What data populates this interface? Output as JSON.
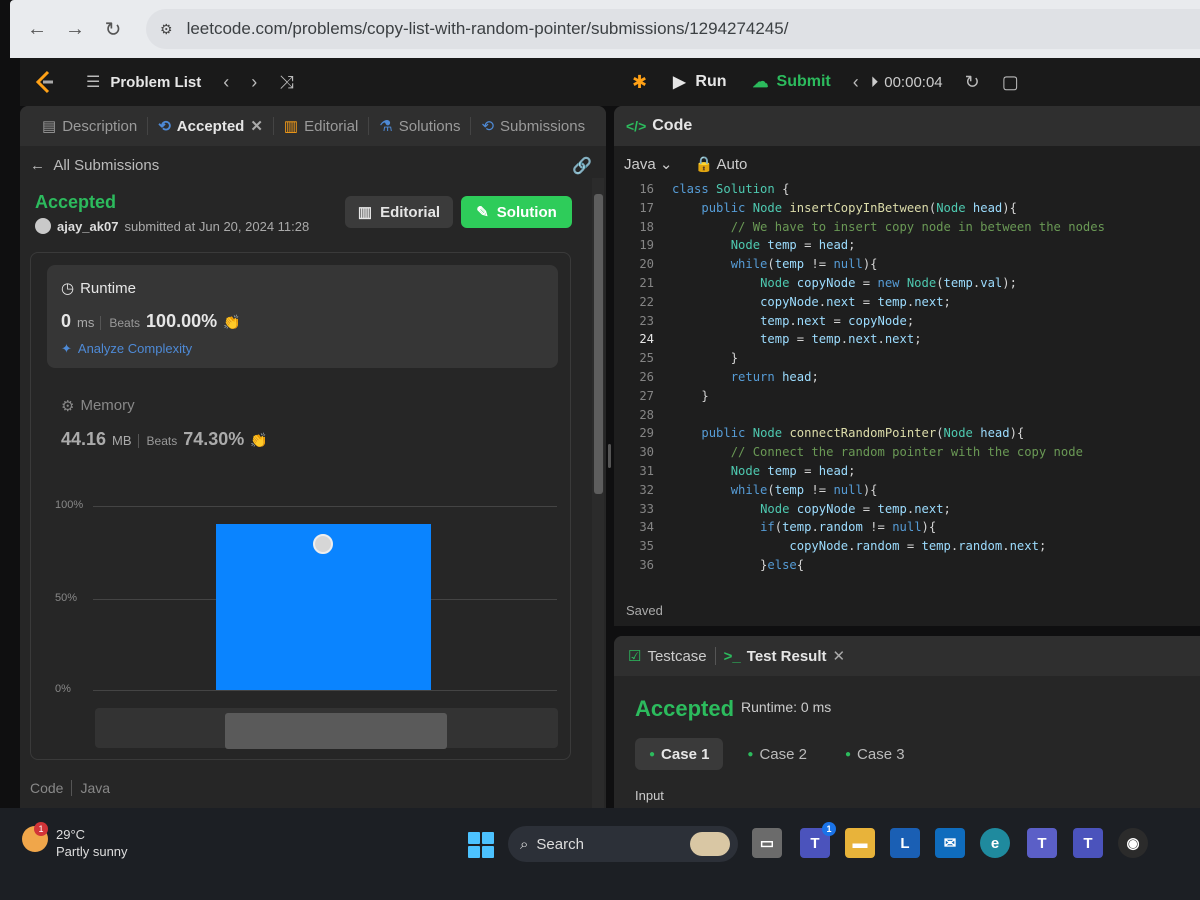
{
  "browser": {
    "url": "leetcode.com/problems/copy-list-with-random-pointer/submissions/1294274245/"
  },
  "topbar": {
    "problem_list": "Problem List",
    "run": "Run",
    "submit": "Submit",
    "timer": "00:00:04"
  },
  "left": {
    "tabs": [
      {
        "label": "Description"
      },
      {
        "label": "Accepted"
      },
      {
        "label": "Editorial"
      },
      {
        "label": "Solutions"
      },
      {
        "label": "Submissions"
      }
    ],
    "all_submissions": "All Submissions",
    "status": "Accepted",
    "user": "ajay_ak07",
    "submitted_text": "submitted at Jun 20, 2024 11:28",
    "editorial_btn": "Editorial",
    "solution_btn": "Solution",
    "runtime": {
      "title": "Runtime",
      "value": "0",
      "unit": "ms",
      "beats_label": "Beats",
      "beats": "100.00%",
      "analyze": "Analyze Complexity"
    },
    "memory": {
      "title": "Memory",
      "value": "44.16",
      "unit": "MB",
      "beats_label": "Beats",
      "beats": "74.30%"
    },
    "code_footer": {
      "code": "Code",
      "lang": "Java"
    }
  },
  "chart_data": {
    "type": "bar",
    "y_ticks": [
      "100%",
      "50%",
      "0%"
    ],
    "ylim": [
      0,
      100
    ],
    "bars": [
      {
        "value": 90,
        "highlighted": true
      }
    ],
    "color": "#0a84ff"
  },
  "code": {
    "title": "Code",
    "language": "Java",
    "mode": "Auto",
    "current_line": 24,
    "lines": [
      {
        "n": 16,
        "text": "class Solution {"
      },
      {
        "n": 17,
        "text": "    public Node insertCopyInBetween(Node head){"
      },
      {
        "n": 18,
        "text": "        // We have to insert copy node in between the nodes"
      },
      {
        "n": 19,
        "text": "        Node temp = head;"
      },
      {
        "n": 20,
        "text": "        while(temp != null){"
      },
      {
        "n": 21,
        "text": "            Node copyNode = new Node(temp.val);"
      },
      {
        "n": 22,
        "text": "            copyNode.next = temp.next;"
      },
      {
        "n": 23,
        "text": "            temp.next = copyNode;"
      },
      {
        "n": 24,
        "text": "            temp = temp.next.next;"
      },
      {
        "n": 25,
        "text": "        }"
      },
      {
        "n": 26,
        "text": "        return head;"
      },
      {
        "n": 27,
        "text": "    }"
      },
      {
        "n": 28,
        "text": ""
      },
      {
        "n": 29,
        "text": "    public Node connectRandomPointer(Node head){"
      },
      {
        "n": 30,
        "text": "        // Connect the random pointer with the copy node"
      },
      {
        "n": 31,
        "text": "        Node temp = head;"
      },
      {
        "n": 32,
        "text": "        while(temp != null){"
      },
      {
        "n": 33,
        "text": "            Node copyNode = temp.next;"
      },
      {
        "n": 34,
        "text": "            if(temp.random != null){"
      },
      {
        "n": 35,
        "text": "                copyNode.random = temp.random.next;"
      },
      {
        "n": 36,
        "text": "            }else{"
      }
    ],
    "saved": "Saved"
  },
  "result": {
    "testcase_tab": "Testcase",
    "test_result_tab": "Test Result",
    "status": "Accepted",
    "runtime": "Runtime: 0 ms",
    "cases": [
      "Case 1",
      "Case 2",
      "Case 3"
    ],
    "input_label": "Input"
  },
  "taskbar": {
    "temperature": "29°C",
    "condition": "Partly sunny",
    "weather_badge": "1",
    "search": "Search",
    "teams_badge": "1"
  }
}
